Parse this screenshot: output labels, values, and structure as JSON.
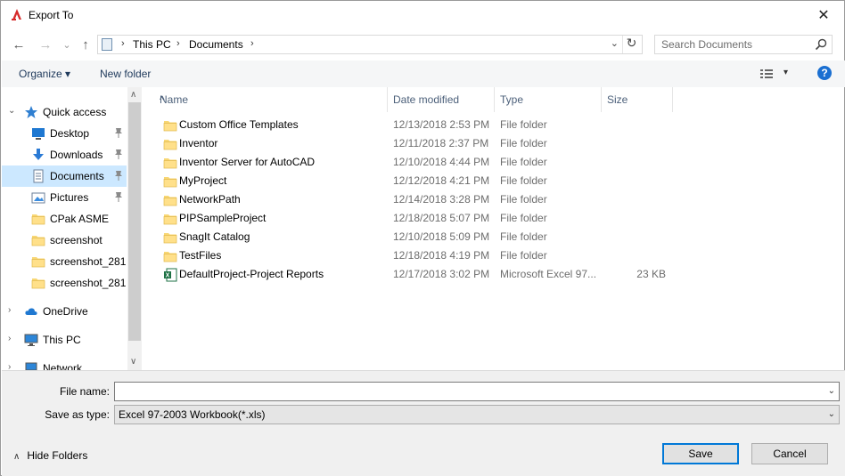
{
  "window": {
    "title": "Export To",
    "close_glyph": "✕",
    "accent_color": "#0078d7",
    "app_icon": "autocad-icon"
  },
  "nav": {
    "back_glyph": "←",
    "forward_glyph": "→",
    "recent_glyph": "⌄",
    "up_glyph": "↑",
    "breadcrumb": [
      "This PC",
      "Documents"
    ],
    "separator": "›",
    "address_dropdown_glyph": "⌄",
    "refresh_glyph": "↻",
    "search_placeholder": "Search Documents"
  },
  "toolbar": {
    "organize_label": "Organize ▾",
    "new_folder_label": "New folder",
    "view_dropdown_glyph": "▾",
    "help_label": "?"
  },
  "sidebar": {
    "items": [
      {
        "label": "Quick access",
        "icon": "star-icon",
        "expand": "⌄",
        "pinned": false,
        "level": 0
      },
      {
        "label": "Desktop",
        "icon": "desktop-icon",
        "expand": "",
        "pinned": true,
        "level": 1
      },
      {
        "label": "Downloads",
        "icon": "download-icon",
        "expand": "",
        "pinned": true,
        "level": 1
      },
      {
        "label": "Documents",
        "icon": "documents-icon",
        "expand": "",
        "pinned": true,
        "level": 1,
        "selected": true
      },
      {
        "label": "Pictures",
        "icon": "pictures-icon",
        "expand": "",
        "pinned": true,
        "level": 1
      },
      {
        "label": "CPak ASME",
        "icon": "folder-icon",
        "expand": "",
        "pinned": false,
        "level": 1
      },
      {
        "label": "screenshot",
        "icon": "folder-icon",
        "expand": "",
        "pinned": false,
        "level": 1
      },
      {
        "label": "screenshot_281",
        "icon": "folder-icon",
        "expand": "",
        "pinned": false,
        "level": 1
      },
      {
        "label": "screenshot_281",
        "icon": "folder-icon",
        "expand": "",
        "pinned": false,
        "level": 1
      },
      {
        "label": "OneDrive",
        "icon": "cloud-icon",
        "expand": "›",
        "pinned": false,
        "level": 0
      },
      {
        "label": "This PC",
        "icon": "computer-icon",
        "expand": "›",
        "pinned": false,
        "level": 0
      },
      {
        "label": "Network",
        "icon": "network-icon",
        "expand": "›",
        "pinned": false,
        "level": 0
      }
    ],
    "scroll_up_glyph": "∧",
    "scroll_down_glyph": "∨"
  },
  "filelist": {
    "columns": [
      "Name",
      "Date modified",
      "Type",
      "Size"
    ],
    "sort_glyph": "^",
    "rows": [
      {
        "name": "Custom Office Templates",
        "date": "12/13/2018 2:53 PM",
        "type": "File folder",
        "size": "",
        "icon": "folder-icon"
      },
      {
        "name": "Inventor",
        "date": "12/11/2018 2:37 PM",
        "type": "File folder",
        "size": "",
        "icon": "folder-icon"
      },
      {
        "name": "Inventor Server for AutoCAD",
        "date": "12/10/2018 4:44 PM",
        "type": "File folder",
        "size": "",
        "icon": "folder-icon"
      },
      {
        "name": "MyProject",
        "date": "12/12/2018 4:21 PM",
        "type": "File folder",
        "size": "",
        "icon": "folder-icon"
      },
      {
        "name": "NetworkPath",
        "date": "12/14/2018 3:28 PM",
        "type": "File folder",
        "size": "",
        "icon": "folder-icon"
      },
      {
        "name": "PIPSampleProject",
        "date": "12/18/2018 5:07 PM",
        "type": "File folder",
        "size": "",
        "icon": "folder-icon"
      },
      {
        "name": "SnagIt Catalog",
        "date": "12/10/2018 5:09 PM",
        "type": "File folder",
        "size": "",
        "icon": "folder-icon"
      },
      {
        "name": "TestFiles",
        "date": "12/18/2018 4:19 PM",
        "type": "File folder",
        "size": "",
        "icon": "folder-icon"
      },
      {
        "name": "DefaultProject-Project Reports",
        "date": "12/17/2018 3:02 PM",
        "type": "Microsoft Excel 97...",
        "size": "23 KB",
        "icon": "excel-file-icon"
      }
    ]
  },
  "footer": {
    "file_name_label": "File name:",
    "file_name_value": "",
    "save_as_type_label": "Save as type:",
    "save_as_type_value": "Excel 97-2003 Workbook(*.xls)",
    "dropdown_glyph": "⌄",
    "hide_folders_label": "Hide Folders",
    "hide_folders_glyph": "∧",
    "save_label": "Save",
    "cancel_label": "Cancel"
  }
}
